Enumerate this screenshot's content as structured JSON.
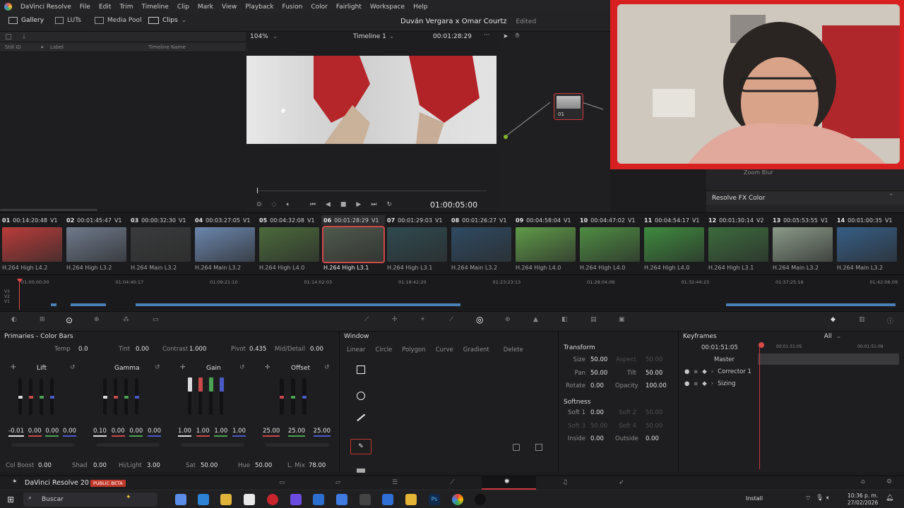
{
  "app_name": "DaVinci Resolve",
  "menu": [
    "File",
    "Edit",
    "Trim",
    "Timeline",
    "Clip",
    "Mark",
    "View",
    "Playback",
    "Fusion",
    "Color",
    "Fairlight",
    "Workspace",
    "Help"
  ],
  "toolbar": {
    "gallery": "Gallery",
    "luts": "LUTs",
    "media_pool": "Media Pool",
    "clips": "Clips",
    "project_title": "Duván Vergara x Omar Courtz",
    "edited": "Edited"
  },
  "gallery": {
    "col_still": "Still ID",
    "col_label": "Label",
    "col_timeline": "Timeline Name"
  },
  "viewer": {
    "zoom": "104%",
    "timeline": "Timeline 1",
    "timecode": "00:01:28:29",
    "playhead_tc": "01:00:05:00"
  },
  "node": {
    "label": "01"
  },
  "fx": {
    "zoom_blur": "Zoom Blur",
    "resolve_fx_color": "Resolve FX Color"
  },
  "clips": [
    {
      "num": "01",
      "tc": "00:14:20:48",
      "track": "V1",
      "codec": "H.264 High L4.2",
      "color": "#b93c3a"
    },
    {
      "num": "02",
      "tc": "00:01:45:47",
      "track": "V1",
      "codec": "H.264 High L3.2",
      "color": "#6f7a8c"
    },
    {
      "num": "03",
      "tc": "00:00:32:30",
      "track": "V1",
      "codec": "H.264 Main L3.2",
      "color": "#3a3b3c"
    },
    {
      "num": "04",
      "tc": "00:03:27:05",
      "track": "V1",
      "codec": "H.264 Main L3.2",
      "color": "#6b86ad"
    },
    {
      "num": "05",
      "tc": "00:04:32:08",
      "track": "V1",
      "codec": "H.264 High L4.0",
      "color": "#4b6a3b"
    },
    {
      "num": "06",
      "tc": "00:01:28:29",
      "track": "V1",
      "codec": "H.264 High L3.1",
      "color": "#4f5a4d"
    },
    {
      "num": "07",
      "tc": "00:01:29:03",
      "track": "V1",
      "codec": "H.264 High L3.1",
      "color": "#2f4a50"
    },
    {
      "num": "08",
      "tc": "00:01:26:27",
      "track": "V1",
      "codec": "H.264 Main L3.2",
      "color": "#2f4a62"
    },
    {
      "num": "09",
      "tc": "00:04:58:04",
      "track": "V1",
      "codec": "H.264 High L4.0",
      "color": "#5f9a48"
    },
    {
      "num": "10",
      "tc": "00:04:47:02",
      "track": "V1",
      "codec": "H.264 High L4.0",
      "color": "#4e8c42"
    },
    {
      "num": "11",
      "tc": "00:04:54:17",
      "track": "V1",
      "codec": "H.264 High L4.0",
      "color": "#3e8a3e"
    },
    {
      "num": "12",
      "tc": "00:01:30:14",
      "track": "V2",
      "codec": "H.264 High L3.1",
      "color": "#3c6b3d"
    },
    {
      "num": "13",
      "tc": "00:05:53:55",
      "track": "V1",
      "codec": "H.264 Main L3.2",
      "color": "#8a9a88"
    },
    {
      "num": "14",
      "tc": "00:01:00:35",
      "track": "V1",
      "codec": "H.264 Main L3.2",
      "color": "#365e86"
    }
  ],
  "ruler": {
    "ticks": [
      "01:00:00:00",
      "01:04:40:17",
      "01:09:21:10",
      "01:14:02:03",
      "01:18:42:20",
      "01:23:23:13",
      "01:28:04:06",
      "01:32:44:23",
      "01:37:25:16",
      "01:42:06:09"
    ],
    "tracks": [
      "V3",
      "V2",
      "V1"
    ]
  },
  "primaries": {
    "title": "Primaries - Color Bars",
    "temp_label": "Temp",
    "temp": "0.0",
    "tint_label": "Tint",
    "tint": "0.00",
    "contrast_label": "Contrast",
    "contrast": "1.000",
    "pivot_label": "Pivot",
    "pivot": "0.435",
    "mid_label": "Mid/Detail",
    "mid": "0.00",
    "wheels": [
      {
        "name": "Lift",
        "values": [
          "-0.01",
          "0.00",
          "0.00",
          "0.00"
        ]
      },
      {
        "name": "Gamma",
        "values": [
          "0.10",
          "0.00",
          "0.00",
          "0.00"
        ]
      },
      {
        "name": "Gain",
        "values": [
          "1.00",
          "1.00",
          "1.00",
          "1.00"
        ]
      },
      {
        "name": "Offset",
        "values": [
          "25.00",
          "25.00",
          "25.00"
        ]
      }
    ],
    "colboost_label": "Col Boost",
    "colboost": "0.00",
    "shad_label": "Shad",
    "shad": "0.00",
    "hilight_label": "Hi/Light",
    "hilight": "3.00",
    "sat_label": "Sat",
    "sat": "50.00",
    "hue_label": "Hue",
    "hue": "50.00",
    "lmix_label": "L. Mix",
    "lmix": "78.00"
  },
  "window": {
    "title": "Window",
    "tools": [
      "Linear",
      "Circle",
      "Polygon",
      "Curve",
      "Gradient",
      "Delete"
    ]
  },
  "transform": {
    "title": "Transform",
    "size_label": "Size",
    "size": "50.00",
    "aspect_label": "Aspect",
    "aspect": "50.00",
    "pan_label": "Pan",
    "pan": "50.00",
    "tilt_label": "Tilt",
    "tilt": "50.00",
    "rotate_label": "Rotate",
    "rotate": "0.00",
    "opacity_label": "Opacity",
    "opacity": "100.00",
    "softness_title": "Softness",
    "soft1_label": "Soft 1",
    "soft1": "0.00",
    "soft2_label": "Soft 2",
    "soft2": "50.00",
    "soft3_label": "Soft 3",
    "soft3": "50.00",
    "soft4_label": "Soft 4",
    "soft4": "50.00",
    "inside_label": "Inside",
    "inside": "0.00",
    "outside_label": "Outside",
    "outside": "0.00"
  },
  "keyframes": {
    "title": "Keyframes",
    "filter": "All",
    "tc": "00:01:51:05",
    "tc_mark": "00:01:51:05",
    "tc_end": "00:01:51:09",
    "rows": [
      "Master",
      "Corrector 1",
      "Sizing"
    ]
  },
  "status": {
    "version": "DaVinci Resolve 20",
    "beta": "PUBLIC BETA"
  },
  "taskbar": {
    "search": "Buscar",
    "install": "Install",
    "time": "10:36 p. m.",
    "date": "27/02/2026"
  }
}
